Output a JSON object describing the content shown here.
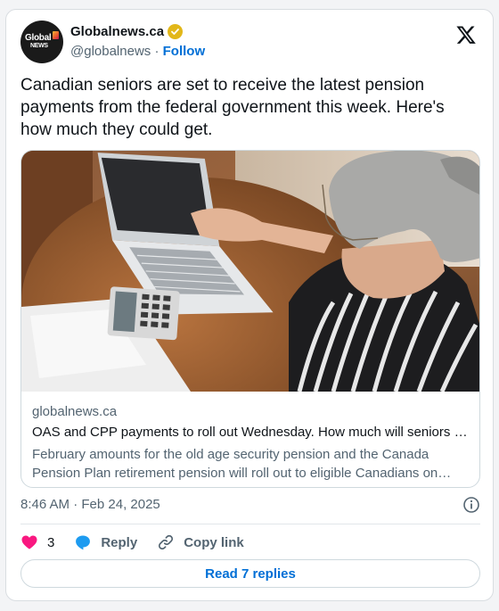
{
  "account": {
    "name": "Globalnews.ca",
    "handle": "@globalnews",
    "separator": " · ",
    "follow_label": "Follow",
    "logo_line1": "Global",
    "logo_line2": "NEWS"
  },
  "tweet": {
    "text": "Canadian seniors are set to receive the latest pension payments from the federal government this week. Here's how much they could get.",
    "timestamp": "8:46 AM · Feb 24, 2025"
  },
  "link_card": {
    "domain": "globalnews.ca",
    "title": "OAS and CPP payments to roll out Wednesday. How much will seniors get?",
    "description": "February amounts for the old age security pension and the Canada Pension Plan retirement pension will roll out to eligible Canadians on Wednesday."
  },
  "actions": {
    "like_count": "3",
    "reply_label": "Reply",
    "copy_link_label": "Copy link"
  },
  "read_replies_label": "Read 7 replies",
  "colors": {
    "accent": "#006fd6",
    "verified_gold": "#e2b719",
    "heart_pink": "#f91880",
    "reply_blue": "#1d9bf0"
  },
  "icons": [
    "x-logo-icon",
    "verified-badge-icon",
    "heart-icon",
    "reply-bubble-icon",
    "link-icon",
    "info-icon"
  ]
}
